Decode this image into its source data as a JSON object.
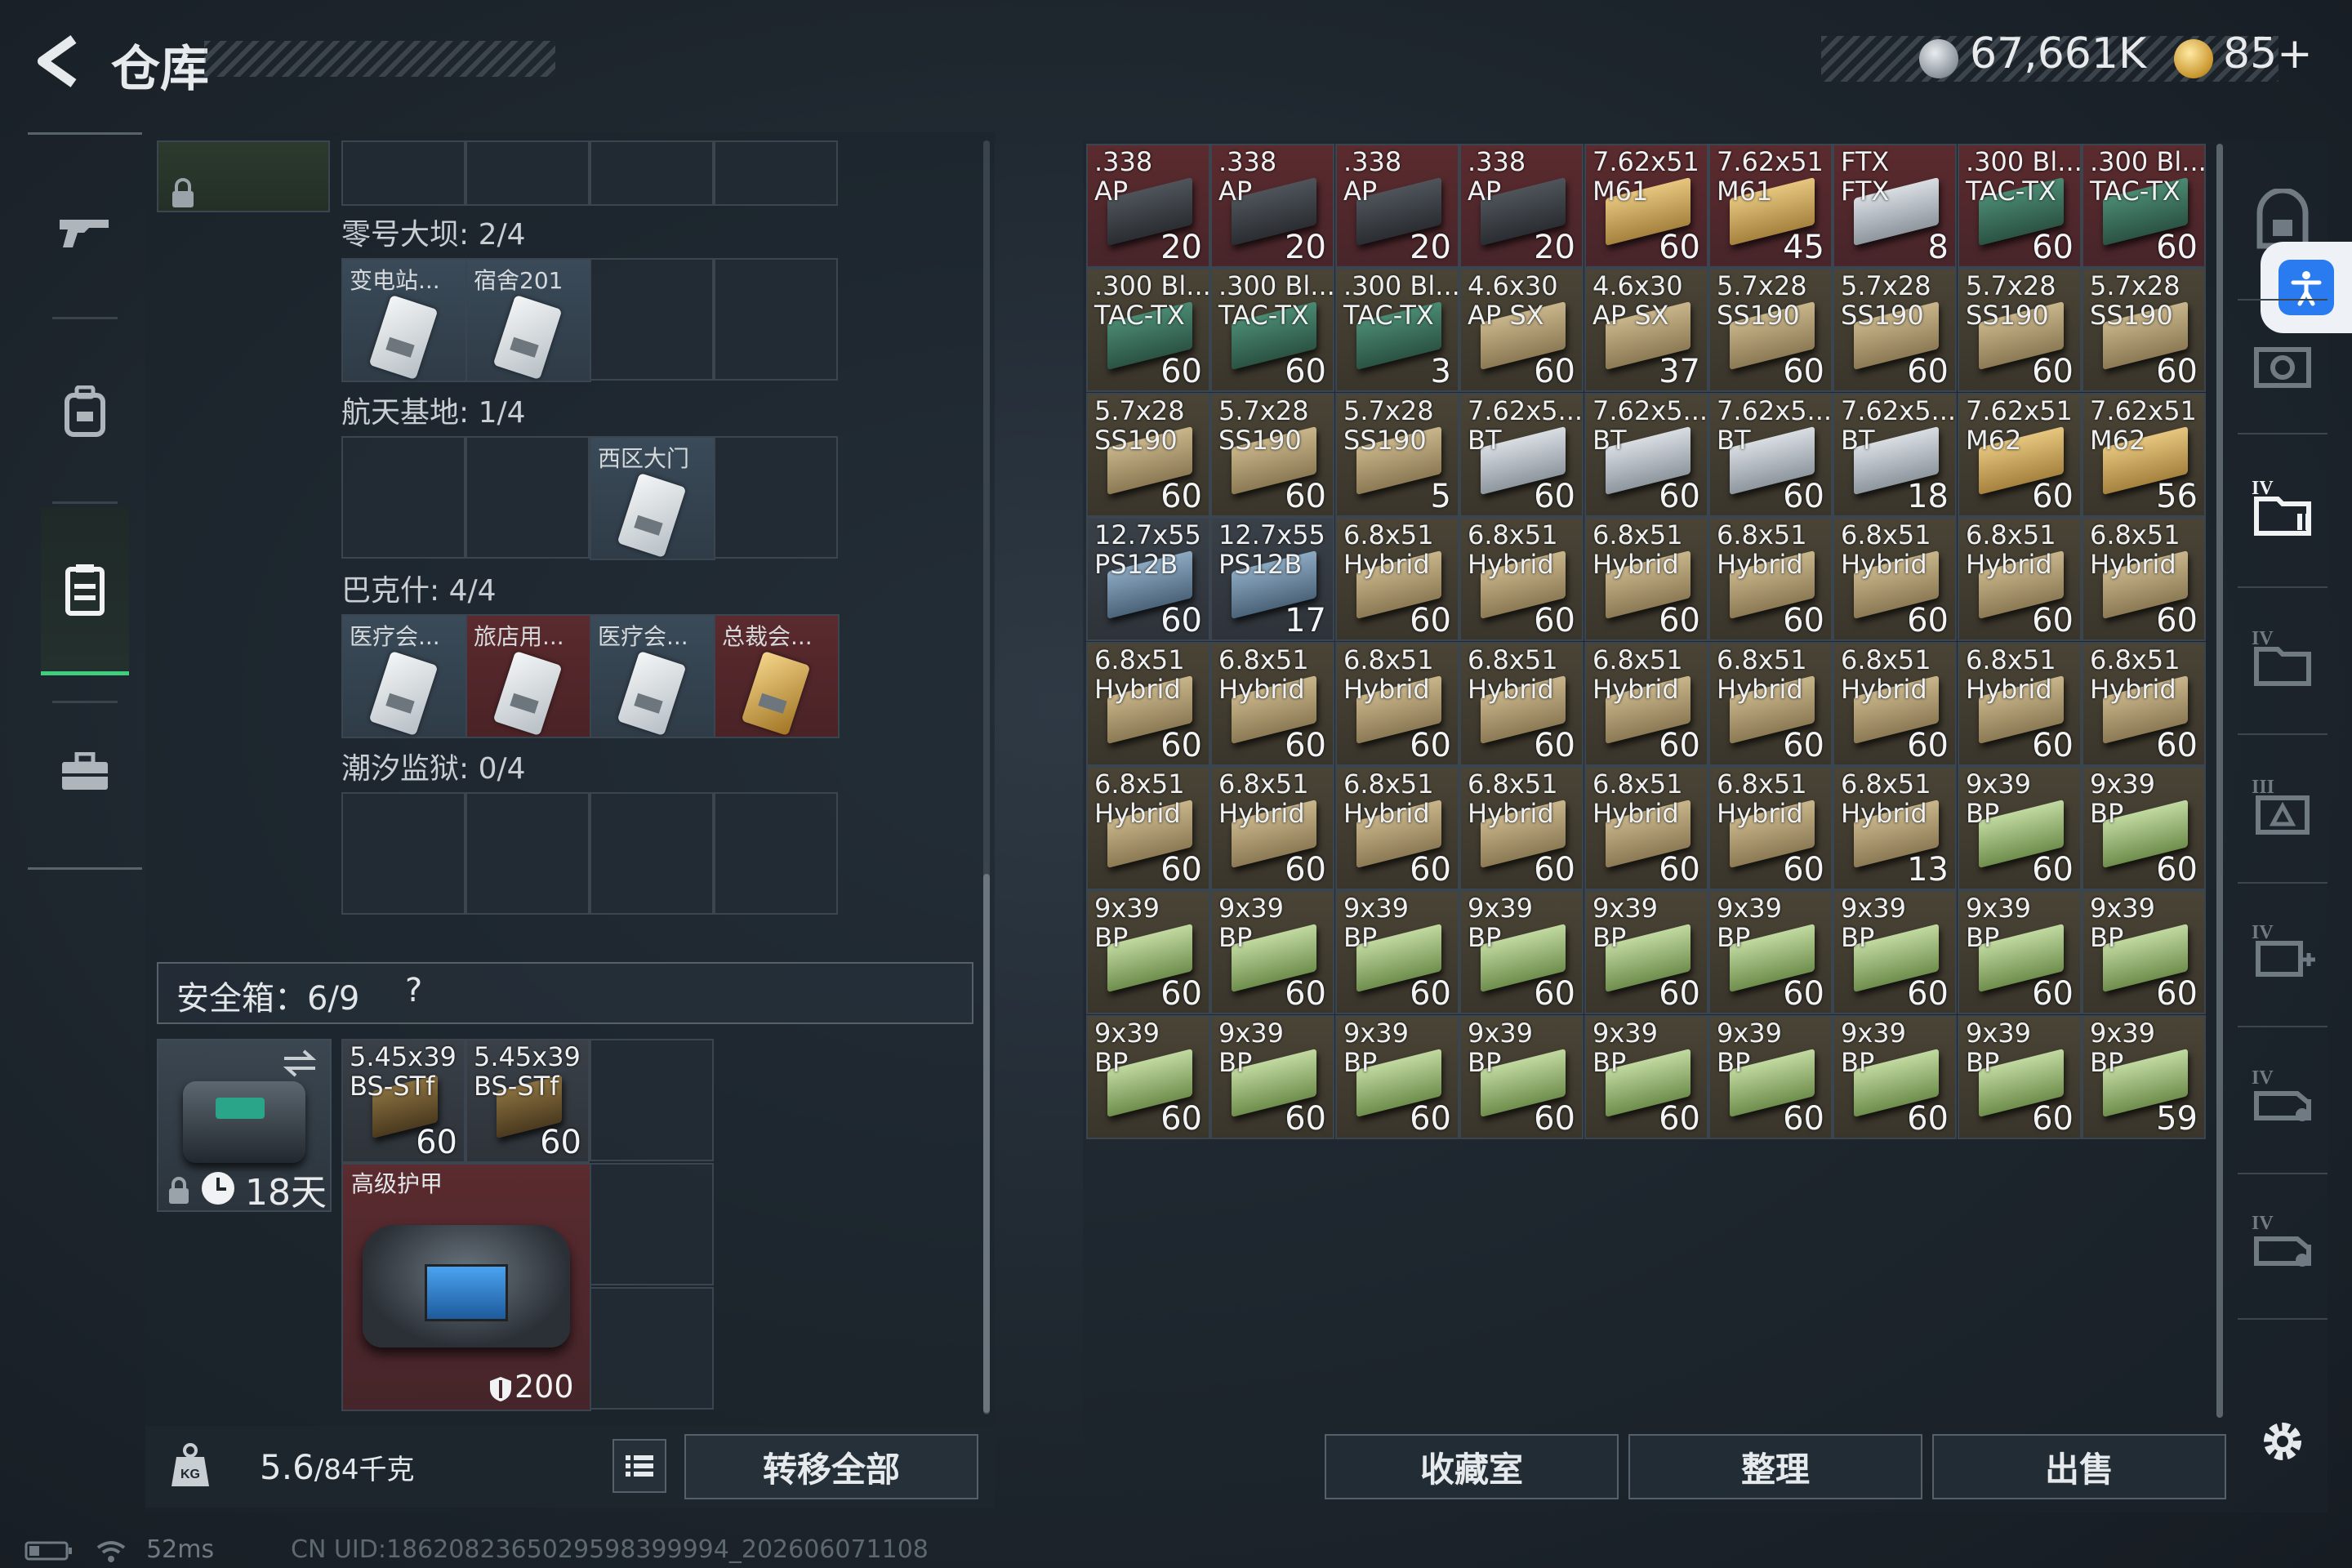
{
  "header": {
    "title": "仓库",
    "silver": "67,661K",
    "gold": "85+"
  },
  "left": {
    "rows": [
      {
        "label": "零号大坝: 2/4",
        "cards": [
          "变电站...",
          "宿舍201"
        ]
      },
      {
        "label": "航天基地: 1/4",
        "cards": [
          "西区大门"
        ]
      },
      {
        "label": "巴克什: 4/4",
        "cards": [
          "医疗会...",
          "旅店用...",
          "医疗会...",
          "总裁会..."
        ]
      },
      {
        "label": "潮汐监狱: 0/4",
        "cards": []
      }
    ],
    "safe": {
      "label": "安全箱：6/9",
      "help": "?",
      "days": "18天",
      "ammo": [
        {
          "name": "5.45x39\nBS-STf",
          "count": "60"
        },
        {
          "name": "5.45x39\nBS-STf",
          "count": "60"
        }
      ],
      "armor": {
        "name": "高级护甲",
        "durability": "200"
      }
    },
    "weight": {
      "value": "5.6",
      "max": "/84千克"
    },
    "transfer_label": "转移全部"
  },
  "stash": [
    {
      "name": ".338\nAP",
      "count": "20",
      "bg": "red",
      "box": "dark"
    },
    {
      "name": ".338\nAP",
      "count": "20",
      "bg": "red",
      "box": "dark"
    },
    {
      "name": ".338\nAP",
      "count": "20",
      "bg": "red",
      "box": "dark"
    },
    {
      "name": ".338\nAP",
      "count": "20",
      "bg": "red",
      "box": "dark"
    },
    {
      "name": "7.62x51\nM61",
      "count": "60",
      "bg": "red",
      "box": "tan"
    },
    {
      "name": "7.62x51\nM61",
      "count": "45",
      "bg": "red",
      "box": "tan"
    },
    {
      "name": "FTX\nFTX",
      "count": "8",
      "bg": "red",
      "box": "silver"
    },
    {
      "name": ".300 Bl...\nTAC-TX",
      "count": "60",
      "bg": "red",
      "box": "green"
    },
    {
      "name": ".300 Bl...\nTAC-TX",
      "count": "60",
      "bg": "red",
      "box": "green"
    },
    {
      "name": ".300 Bl...\nTAC-TX",
      "count": "60",
      "bg": "gold",
      "box": "green"
    },
    {
      "name": ".300 Bl...\nTAC-TX",
      "count": "60",
      "bg": "gold",
      "box": "green"
    },
    {
      "name": ".300 Bl...\nTAC-TX",
      "count": "3",
      "bg": "gold",
      "box": "green"
    },
    {
      "name": "4.6x30\nAP SX",
      "count": "60",
      "bg": "gold",
      "box": "sand"
    },
    {
      "name": "4.6x30\nAP SX",
      "count": "37",
      "bg": "gold",
      "box": "sand"
    },
    {
      "name": "5.7x28\nSS190",
      "count": "60",
      "bg": "gold",
      "box": "sand"
    },
    {
      "name": "5.7x28\nSS190",
      "count": "60",
      "bg": "gold",
      "box": "sand"
    },
    {
      "name": "5.7x28\nSS190",
      "count": "60",
      "bg": "gold",
      "box": "sand"
    },
    {
      "name": "5.7x28\nSS190",
      "count": "60",
      "bg": "gold",
      "box": "sand"
    },
    {
      "name": "5.7x28\nSS190",
      "count": "60",
      "bg": "gold",
      "box": "sand"
    },
    {
      "name": "5.7x28\nSS190",
      "count": "60",
      "bg": "gold",
      "box": "sand"
    },
    {
      "name": "5.7x28\nSS190",
      "count": "5",
      "bg": "gold",
      "box": "sand"
    },
    {
      "name": "7.62x5...\nBT",
      "count": "60",
      "bg": "gold",
      "box": "silver"
    },
    {
      "name": "7.62x5...\nBT",
      "count": "60",
      "bg": "gold",
      "box": "silver"
    },
    {
      "name": "7.62x5...\nBT",
      "count": "60",
      "bg": "gold",
      "box": "silver"
    },
    {
      "name": "7.62x5...\nBT",
      "count": "18",
      "bg": "gold",
      "box": "silver"
    },
    {
      "name": "7.62x51\nM62",
      "count": "60",
      "bg": "gold",
      "box": "tan"
    },
    {
      "name": "7.62x51\nM62",
      "count": "56",
      "bg": "gold",
      "box": "tan"
    },
    {
      "name": "12.7x55\nPS12B",
      "count": "60",
      "bg": "grey",
      "box": "blue"
    },
    {
      "name": "12.7x55\nPS12B",
      "count": "17",
      "bg": "grey",
      "box": "blue"
    },
    {
      "name": "6.8x51\nHybrid",
      "count": "60",
      "bg": "gold",
      "box": "sand"
    },
    {
      "name": "6.8x51\nHybrid",
      "count": "60",
      "bg": "gold",
      "box": "sand"
    },
    {
      "name": "6.8x51\nHybrid",
      "count": "60",
      "bg": "gold",
      "box": "sand"
    },
    {
      "name": "6.8x51\nHybrid",
      "count": "60",
      "bg": "gold",
      "box": "sand"
    },
    {
      "name": "6.8x51\nHybrid",
      "count": "60",
      "bg": "gold",
      "box": "sand"
    },
    {
      "name": "6.8x51\nHybrid",
      "count": "60",
      "bg": "gold",
      "box": "sand"
    },
    {
      "name": "6.8x51\nHybrid",
      "count": "60",
      "bg": "gold",
      "box": "sand"
    },
    {
      "name": "6.8x51\nHybrid",
      "count": "60",
      "bg": "gold",
      "box": "sand"
    },
    {
      "name": "6.8x51\nHybrid",
      "count": "60",
      "bg": "gold",
      "box": "sand"
    },
    {
      "name": "6.8x51\nHybrid",
      "count": "60",
      "bg": "gold",
      "box": "sand"
    },
    {
      "name": "6.8x51\nHybrid",
      "count": "60",
      "bg": "gold",
      "box": "sand"
    },
    {
      "name": "6.8x51\nHybrid",
      "count": "60",
      "bg": "gold",
      "box": "sand"
    },
    {
      "name": "6.8x51\nHybrid",
      "count": "60",
      "bg": "gold",
      "box": "sand"
    },
    {
      "name": "6.8x51\nHybrid",
      "count": "60",
      "bg": "gold",
      "box": "sand"
    },
    {
      "name": "6.8x51\nHybrid",
      "count": "60",
      "bg": "gold",
      "box": "sand"
    },
    {
      "name": "6.8x51\nHybrid",
      "count": "60",
      "bg": "gold",
      "box": "sand"
    },
    {
      "name": "6.8x51\nHybrid",
      "count": "60",
      "bg": "gold",
      "box": "sand"
    },
    {
      "name": "6.8x51\nHybrid",
      "count": "60",
      "bg": "gold",
      "box": "sand"
    },
    {
      "name": "6.8x51\nHybrid",
      "count": "60",
      "bg": "gold",
      "box": "sand"
    },
    {
      "name": "6.8x51\nHybrid",
      "count": "60",
      "bg": "gold",
      "box": "sand"
    },
    {
      "name": "6.8x51\nHybrid",
      "count": "60",
      "bg": "gold",
      "box": "sand"
    },
    {
      "name": "6.8x51\nHybrid",
      "count": "60",
      "bg": "gold",
      "box": "sand"
    },
    {
      "name": "6.8x51\nHybrid",
      "count": "13",
      "bg": "gold",
      "box": "sand"
    },
    {
      "name": "9x39\nBP",
      "count": "60",
      "bg": "gold",
      "box": "lime"
    },
    {
      "name": "9x39\nBP",
      "count": "60",
      "bg": "gold",
      "box": "lime"
    },
    {
      "name": "9x39\nBP",
      "count": "60",
      "bg": "gold",
      "box": "lime"
    },
    {
      "name": "9x39\nBP",
      "count": "60",
      "bg": "gold",
      "box": "lime"
    },
    {
      "name": "9x39\nBP",
      "count": "60",
      "bg": "gold",
      "box": "lime"
    },
    {
      "name": "9x39\nBP",
      "count": "60",
      "bg": "gold",
      "box": "lime"
    },
    {
      "name": "9x39\nBP",
      "count": "60",
      "bg": "gold",
      "box": "lime"
    },
    {
      "name": "9x39\nBP",
      "count": "60",
      "bg": "gold",
      "box": "lime"
    },
    {
      "name": "9x39\nBP",
      "count": "60",
      "bg": "gold",
      "box": "lime"
    },
    {
      "name": "9x39\nBP",
      "count": "60",
      "bg": "gold",
      "box": "lime"
    },
    {
      "name": "9x39\nBP",
      "count": "60",
      "bg": "gold",
      "box": "lime"
    },
    {
      "name": "9x39\nBP",
      "count": "60",
      "bg": "gold",
      "box": "lime"
    },
    {
      "name": "9x39\nBP",
      "count": "60",
      "bg": "gold",
      "box": "lime"
    },
    {
      "name": "9x39\nBP",
      "count": "60",
      "bg": "gold",
      "box": "lime"
    },
    {
      "name": "9x39\nBP",
      "count": "60",
      "bg": "gold",
      "box": "lime"
    },
    {
      "name": "9x39\nBP",
      "count": "60",
      "bg": "gold",
      "box": "lime"
    },
    {
      "name": "9x39\nBP",
      "count": "60",
      "bg": "gold",
      "box": "lime"
    },
    {
      "name": "9x39\nBP",
      "count": "60",
      "bg": "gold",
      "box": "lime"
    },
    {
      "name": "9x39\nBP",
      "count": "60",
      "bg": "gold",
      "box": "lime"
    },
    {
      "name": "9x39\nBP",
      "count": "59",
      "bg": "gold",
      "box": "lime"
    }
  ],
  "actions": [
    "收藏室",
    "整理",
    "出售"
  ],
  "status": {
    "ping": "52ms",
    "uid": "CN UID:1862082365029598399994_202606071108"
  },
  "colors": {
    "accent": "#3fcf7c",
    "red_bg": "#5b2b2e",
    "access_blue": "#2b7bf0"
  },
  "icons": [
    "back-arrow-icon",
    "gun-icon",
    "backpack-icon",
    "storage-icon",
    "toolbox-icon",
    "lock-icon",
    "clock-icon",
    "swap-icon",
    "shield-icon",
    "weight-icon",
    "list-icon",
    "settings-icon",
    "accessibility-icon",
    "battery-icon",
    "wifi-icon"
  ]
}
